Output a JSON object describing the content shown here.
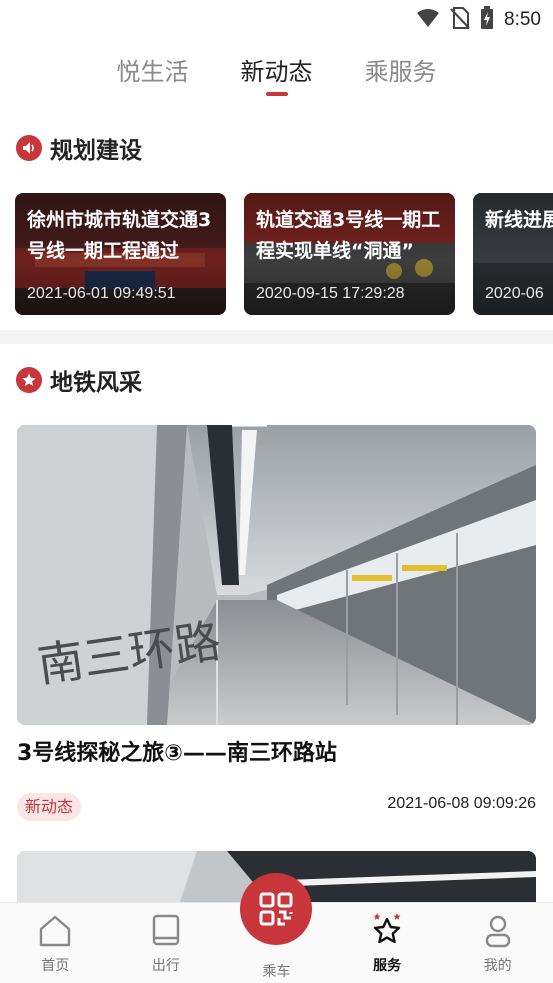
{
  "status_bar": {
    "time": "8:50"
  },
  "top_tabs": [
    {
      "label": "悦生活",
      "active": false
    },
    {
      "label": "新动态",
      "active": true
    },
    {
      "label": "乘服务",
      "active": false
    }
  ],
  "planning": {
    "title": "规划建设",
    "cards": [
      {
        "title": "徐州市城市轨道交通3号线一期工程通过",
        "date": "2021-06-01 09:49:51"
      },
      {
        "title": "轨道交通3号线一期工程实现单线“洞通”",
        "date": "2020-09-15 17:29:28"
      },
      {
        "title": "新线进展快推进车",
        "date": "2020-06"
      }
    ]
  },
  "metro_style": {
    "title": "地铁风采",
    "featured": {
      "title": "3号线探秘之旅③——南三环路站",
      "tag": "新动态",
      "date": "2021-06-08 09:09:26",
      "image_sign_text": "南三环路"
    }
  },
  "bottom_nav": [
    {
      "label": "首页",
      "icon": "home-icon"
    },
    {
      "label": "出行",
      "icon": "book-icon"
    },
    {
      "label": "乘车",
      "icon": "qr-code-icon"
    },
    {
      "label": "服务",
      "icon": "star-icon",
      "active": true
    },
    {
      "label": "我的",
      "icon": "user-icon"
    }
  ],
  "colors": {
    "accent": "#c8353a",
    "tag_bg": "#fbe6e7",
    "divider": "#f3f3f3"
  }
}
